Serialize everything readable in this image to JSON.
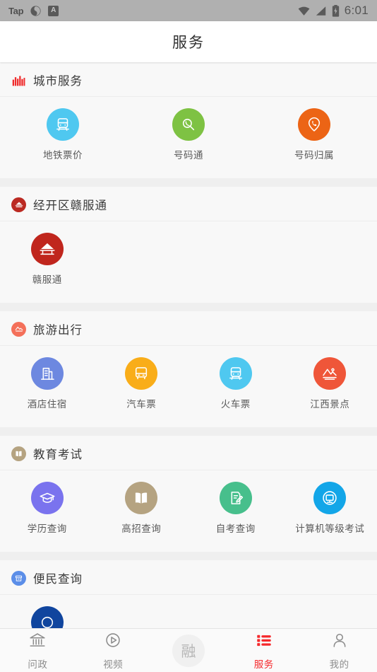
{
  "statusbar": {
    "app_label": "Tap",
    "swirl_icon": "swirl-icon",
    "badge_icon_letter": "A",
    "wifi_icon": "wifi-icon",
    "signal_icon": "signal-icon",
    "battery_icon": "battery-charging-icon",
    "time": "6:01"
  },
  "header": {
    "title": "服务"
  },
  "sections": [
    {
      "title": "城市服务",
      "icon": "city-skyline-icon",
      "icon_color": "#ef2b2b",
      "columns": 3,
      "items": [
        {
          "label": "地铁票价",
          "icon": "subway-icon",
          "color": "#4fc8f0"
        },
        {
          "label": "号码通",
          "icon": "phone-search-icon",
          "color": "#7ec243"
        },
        {
          "label": "号码归属",
          "icon": "phone-location-icon",
          "color": "#ec6415"
        }
      ]
    },
    {
      "title": "经开区赣服通",
      "icon": "pavilion-icon",
      "icon_color": "#bb2a22",
      "columns": 4,
      "items": [
        {
          "label": "赣服通",
          "icon": "pavilion-icon",
          "color": "#c0261d"
        }
      ]
    },
    {
      "title": "旅游出行",
      "icon": "landscape-icon",
      "icon_color": "#f4705a",
      "columns": 4,
      "items": [
        {
          "label": "酒店住宿",
          "icon": "hotel-icon",
          "color": "#6d88e0"
        },
        {
          "label": "汽车票",
          "icon": "bus-icon",
          "color": "#f9ad19"
        },
        {
          "label": "火车票",
          "icon": "train-icon",
          "color": "#4fc8f0"
        },
        {
          "label": "江西景点",
          "icon": "mountain-icon",
          "color": "#ef5639"
        }
      ]
    },
    {
      "title": "教育考试",
      "icon": "book-icon",
      "icon_color": "#b5a381",
      "columns": 4,
      "items": [
        {
          "label": "学历查询",
          "icon": "graduation-cap-icon",
          "color": "#7a73ee"
        },
        {
          "label": "高招查询",
          "icon": "open-book-icon",
          "color": "#b5a381"
        },
        {
          "label": "自考查询",
          "icon": "notepad-pen-icon",
          "color": "#47bf8c"
        },
        {
          "label": "计算机等级考试",
          "icon": "monitor-icon",
          "color": "#13a6e8"
        }
      ]
    },
    {
      "title": "便民查询",
      "icon": "archive-icon",
      "icon_color": "#5b8ee8",
      "columns": 4,
      "items": [
        {
          "label": "",
          "icon": "clipped-icon",
          "color": "#10459e"
        }
      ]
    }
  ],
  "tabbar": {
    "items": [
      {
        "label": "问政",
        "icon": "bank-icon",
        "active": false
      },
      {
        "label": "视频",
        "icon": "play-circle-icon",
        "active": false
      },
      {
        "label": "融",
        "icon": "rong-center-icon",
        "active": false,
        "center": true
      },
      {
        "label": "服务",
        "icon": "list-icon",
        "active": true
      },
      {
        "label": "我的",
        "icon": "person-icon",
        "active": false
      }
    ],
    "active_color": "#f5292c",
    "inactive_color": "#8c8c8c"
  }
}
